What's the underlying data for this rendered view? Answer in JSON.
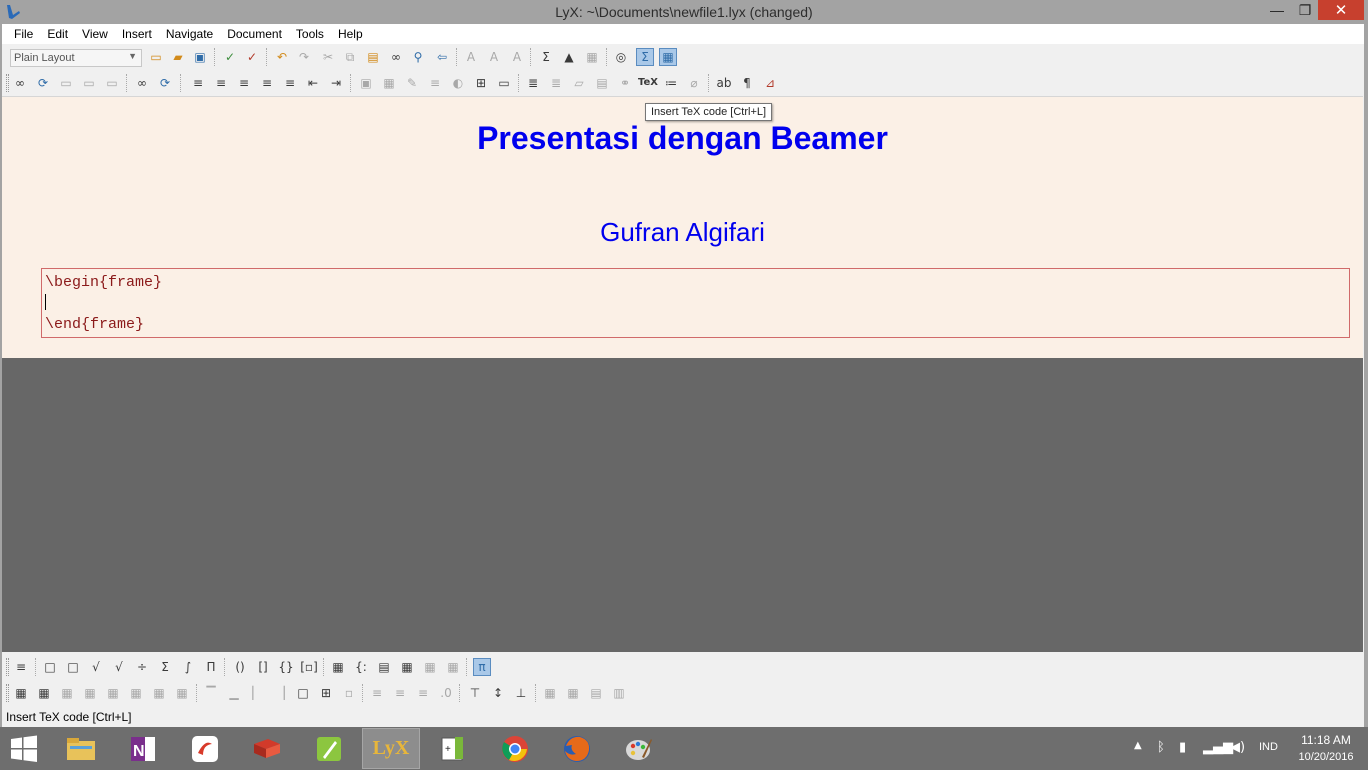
{
  "window": {
    "title": "LyX: ~\\Documents\\newfile1.lyx (changed)",
    "minimize_glyph": "—",
    "maximize_glyph": "❐",
    "close_glyph": "✕"
  },
  "menubar": {
    "items": [
      "File",
      "Edit",
      "View",
      "Insert",
      "Navigate",
      "Document",
      "Tools",
      "Help"
    ]
  },
  "toolbar": {
    "layout_select": "Plain Layout",
    "tooltip": "Insert TeX code [Ctrl+L]"
  },
  "document": {
    "title": "Presentasi dengan Beamer",
    "author": "Gufran Algifari",
    "ert_lines": [
      "\\begin{frame}",
      "",
      "\\end{frame}"
    ]
  },
  "statusbar": {
    "text": "Insert TeX code [Ctrl+L]"
  },
  "taskbar": {
    "apps": [
      "file-explorer",
      "onenote",
      "swiftkey",
      "book-reader",
      "app-green",
      "lyx",
      "texmaker",
      "chrome",
      "firefox",
      "paint"
    ],
    "active_app": "lyx",
    "language": "IND",
    "time": "11:18 AM",
    "date": "10/20/2016"
  },
  "colors": {
    "document_bg": "#fbf0e6",
    "heading_blue": "#0000ee",
    "ert_text": "#8b1a1a",
    "ert_border": "#d06a6a",
    "workarea_bg": "#676767",
    "close_red": "#c7402e"
  }
}
